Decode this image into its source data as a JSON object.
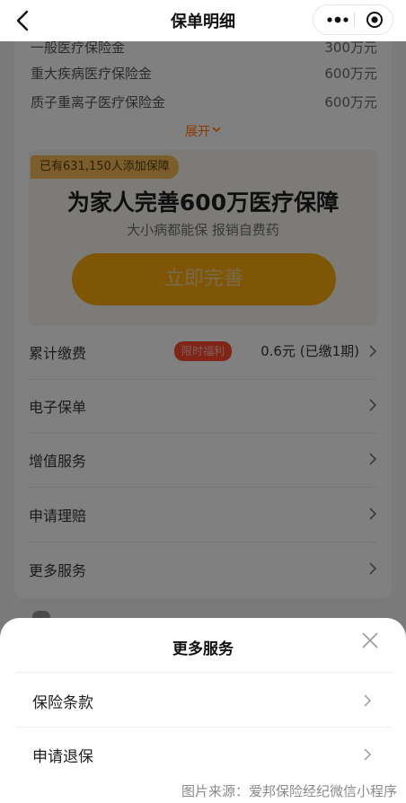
{
  "nav": {
    "title": "保单明细"
  },
  "coverage_rows": [
    {
      "label": "一般医疗保险金",
      "value": "300万元"
    },
    {
      "label": "重大疾病医疗保险金",
      "value": "600万元"
    },
    {
      "label": "质子重离子医疗保险金",
      "value": "600万元"
    }
  ],
  "expand_label": "展开",
  "promo": {
    "badge": "已有631,150人添加保障",
    "title": "为家人完善600万医疗保障",
    "subtitle": "大小病都能保 报销自费药",
    "cta": "立即完善"
  },
  "services": [
    {
      "label": "累计缴费",
      "tag": "限时福利",
      "value": "0.6元 (已缴1期)"
    },
    {
      "label": "电子保单"
    },
    {
      "label": "增值服务"
    },
    {
      "label": "申请理赔"
    },
    {
      "label": "更多服务"
    }
  ],
  "sheet": {
    "title": "更多服务",
    "items": [
      {
        "label": "保险条款"
      },
      {
        "label": "申请退保"
      }
    ]
  },
  "watermark": "图片来源：爱邦保险经纪微信小程序"
}
